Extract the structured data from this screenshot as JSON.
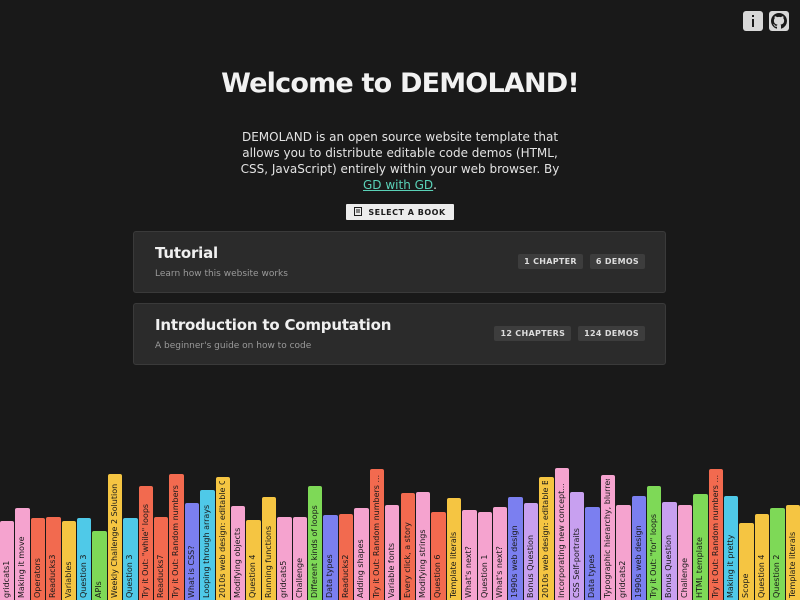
{
  "header": {
    "info_icon": "info-icon",
    "github_icon": "github-icon"
  },
  "hero": {
    "title": "Welcome to DEMOLAND!",
    "intro_text": "DEMOLAND is an open source website template that allows you to distribute editable code demos (HTML, CSS, JavaScript) entirely within your web browser. By ",
    "intro_link": "GD with GD",
    "intro_end": "."
  },
  "select_book": {
    "label": "SELECT A BOOK",
    "icon": "book-icon"
  },
  "books": [
    {
      "title": "Tutorial",
      "subtitle": "Learn how this website works",
      "chapters": "1 CHAPTER",
      "demos": "6 DEMOS"
    },
    {
      "title": "Introduction to Computation",
      "subtitle": "A beginner's guide on how to code",
      "chapters": "12 CHAPTERS",
      "demos": "124 DEMOS"
    }
  ],
  "shelf": {
    "colors": {
      "pink": "#f5a3cf",
      "orange": "#f26a4f",
      "yellow": "#f5c542",
      "blue": "#7b7ff0",
      "green": "#7ed957",
      "cyan": "#4fc9e8",
      "lavender": "#c8a0f0"
    },
    "books": [
      {
        "label": "gridcats1",
        "color": "pink",
        "height": 0.42
      },
      {
        "label": "Making it move",
        "color": "pink",
        "height": 0.56
      },
      {
        "label": "Operators",
        "color": "orange",
        "height": 0.46
      },
      {
        "label": "Readucks3",
        "color": "orange",
        "height": 0.47
      },
      {
        "label": "Variables",
        "color": "yellow",
        "height": 0.42
      },
      {
        "label": "Question 3",
        "color": "cyan",
        "height": 0.46
      },
      {
        "label": "APIs",
        "color": "green",
        "height": 0.32
      },
      {
        "label": "Weekly Challenge 2 Solution",
        "color": "yellow",
        "height": 0.94
      },
      {
        "label": "Question 3",
        "color": "cyan",
        "height": 0.46
      },
      {
        "label": "Try it Out: \"while\" loops",
        "color": "orange",
        "height": 0.8
      },
      {
        "label": "Readucks7",
        "color": "orange",
        "height": 0.47
      },
      {
        "label": "Try it Out: Random numbers",
        "color": "orange",
        "height": 0.94
      },
      {
        "label": "What is CSS?",
        "color": "blue",
        "height": 0.62
      },
      {
        "label": "Looping through arrays",
        "color": "cyan",
        "height": 0.76
      },
      {
        "label": "2010s web design: editable C",
        "color": "yellow",
        "height": 0.9
      },
      {
        "label": "Modifying objects",
        "color": "pink",
        "height": 0.59
      },
      {
        "label": "Question 4",
        "color": "yellow",
        "height": 0.44
      },
      {
        "label": "Running functions",
        "color": "yellow",
        "height": 0.69
      },
      {
        "label": "gridcats5",
        "color": "pink",
        "height": 0.47
      },
      {
        "label": "Challenge",
        "color": "pink",
        "height": 0.47
      },
      {
        "label": "Different kinds of loops",
        "color": "green",
        "height": 0.8
      },
      {
        "label": "Data types",
        "color": "blue",
        "height": 0.49
      },
      {
        "label": "Readucks2",
        "color": "orange",
        "height": 0.5
      },
      {
        "label": "Adding shapes",
        "color": "pink",
        "height": 0.57
      },
      {
        "label": "Try it Out: Random numbers ...",
        "color": "orange",
        "height": 0.99
      },
      {
        "label": "Variable fonts",
        "color": "pink",
        "height": 0.6
      },
      {
        "label": "Every click, a story",
        "color": "orange",
        "height": 0.73
      },
      {
        "label": "Modifying strings",
        "color": "pink",
        "height": 0.74
      },
      {
        "label": "Question 6",
        "color": "orange",
        "height": 0.52
      },
      {
        "label": "Template literals",
        "color": "yellow",
        "height": 0.67
      },
      {
        "label": "What's next?",
        "color": "pink",
        "height": 0.54
      },
      {
        "label": "Question 1",
        "color": "pink",
        "height": 0.52
      },
      {
        "label": "What's next?",
        "color": "pink",
        "height": 0.58
      },
      {
        "label": "1990s web design",
        "color": "blue",
        "height": 0.68
      },
      {
        "label": "Bonus Question",
        "color": "lavender",
        "height": 0.62
      },
      {
        "label": "2010s web design: editable B",
        "color": "yellow",
        "height": 0.9
      },
      {
        "label": "Incorporating new concept...",
        "color": "pink",
        "height": 1.0
      },
      {
        "label": "CSS Self-portraits",
        "color": "lavender",
        "height": 0.74
      },
      {
        "label": "Data types",
        "color": "blue",
        "height": 0.58
      },
      {
        "label": "Typographic hierarchy, blurred",
        "color": "pink",
        "height": 0.92
      },
      {
        "label": "gridcats2",
        "color": "pink",
        "height": 0.6
      },
      {
        "label": "1990s web design",
        "color": "blue",
        "height": 0.7
      },
      {
        "label": "Try it Out: \"for\" loops",
        "color": "green",
        "height": 0.8
      },
      {
        "label": "Bonus Question",
        "color": "lavender",
        "height": 0.63
      },
      {
        "label": "Challenge",
        "color": "pink",
        "height": 0.6
      },
      {
        "label": "HTML template",
        "color": "green",
        "height": 0.72
      },
      {
        "label": "Try it Out: Random numbers ...",
        "color": "orange",
        "height": 0.99
      },
      {
        "label": "Making it pretty",
        "color": "cyan",
        "height": 0.7
      },
      {
        "label": "Scope",
        "color": "yellow",
        "height": 0.4
      },
      {
        "label": "Question 4",
        "color": "yellow",
        "height": 0.5
      },
      {
        "label": "Question 2",
        "color": "green",
        "height": 0.56
      },
      {
        "label": "Template literals",
        "color": "yellow",
        "height": 0.6
      }
    ]
  }
}
